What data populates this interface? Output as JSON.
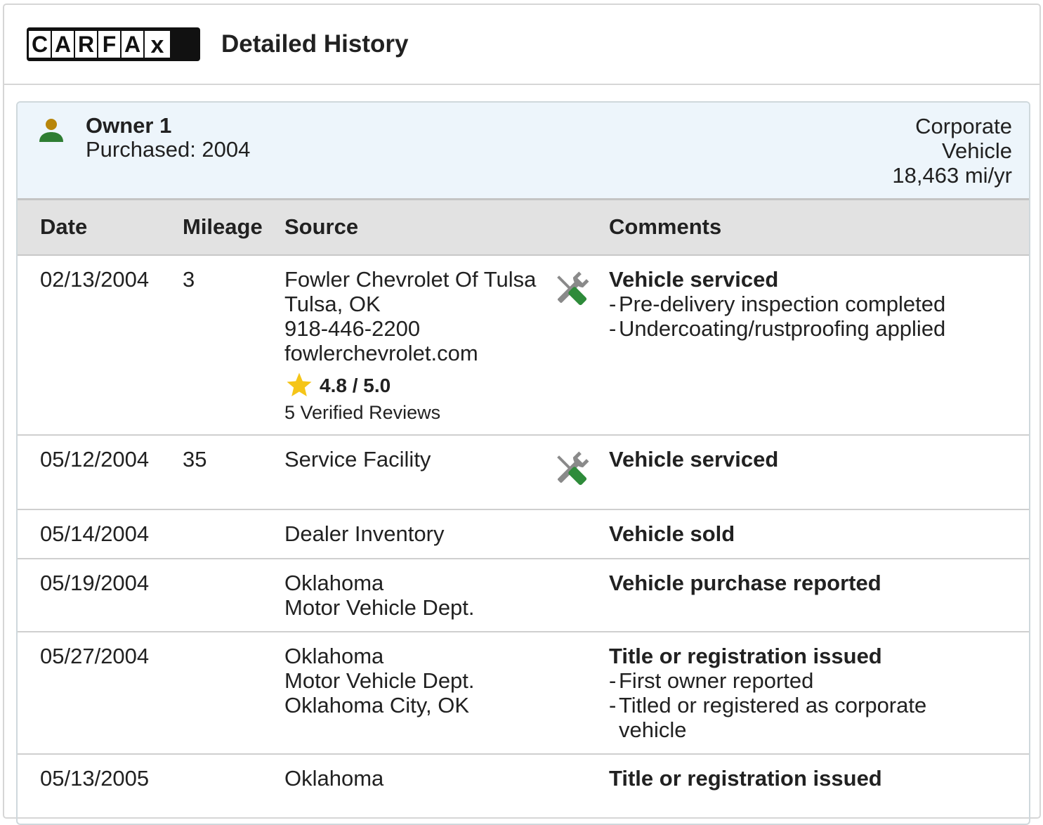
{
  "header": {
    "logo_letters": [
      "C",
      "A",
      "R",
      "F",
      "A",
      "x"
    ],
    "title": "Detailed History"
  },
  "owner": {
    "title": "Owner 1",
    "purchased": "Purchased: 2004",
    "type_line1": "Corporate",
    "type_line2": "Vehicle",
    "miles_per_year": "18,463 mi/yr"
  },
  "columns": {
    "date": "Date",
    "mileage": "Mileage",
    "source": "Source",
    "comments": "Comments"
  },
  "rows": [
    {
      "date": "02/13/2004",
      "mileage": "3",
      "source": [
        "Fowler Chevrolet Of Tulsa",
        "Tulsa, OK",
        "918-446-2200",
        "fowlerchevrolet.com"
      ],
      "rating": "4.8 / 5.0",
      "reviews": "5 Verified Reviews",
      "icon": "service-wrench-icon",
      "title": "Vehicle serviced",
      "details": [
        "Pre-delivery inspection completed",
        "Undercoating/rustproofing applied"
      ]
    },
    {
      "date": "05/12/2004",
      "mileage": "35",
      "source": [
        "Service Facility"
      ],
      "icon": "service-wrench-icon",
      "title": "Vehicle serviced"
    },
    {
      "date": "05/14/2004",
      "source": [
        "Dealer Inventory"
      ],
      "title": "Vehicle sold"
    },
    {
      "date": "05/19/2004",
      "source": [
        "Oklahoma",
        "Motor Vehicle Dept."
      ],
      "title": "Vehicle purchase reported"
    },
    {
      "date": "05/27/2004",
      "source": [
        "Oklahoma",
        "Motor Vehicle Dept.",
        "Oklahoma City, OK"
      ],
      "title": "Title or registration issued",
      "details": [
        "First owner reported",
        "Titled or registered as corporate",
        "vehicle"
      ]
    },
    {
      "date": "05/13/2005",
      "source": [
        "Oklahoma"
      ],
      "title": "Title or registration issued"
    }
  ],
  "colors": {
    "owner_panel_bg": "#edf5fb",
    "table_head_bg": "#e2e2e2",
    "star": "#f5c518",
    "wrench_gray": "#8a8a8a",
    "screwdriver_green": "#2e8b3a",
    "owner_head": "#b8860b",
    "owner_body": "#2e7d32"
  }
}
